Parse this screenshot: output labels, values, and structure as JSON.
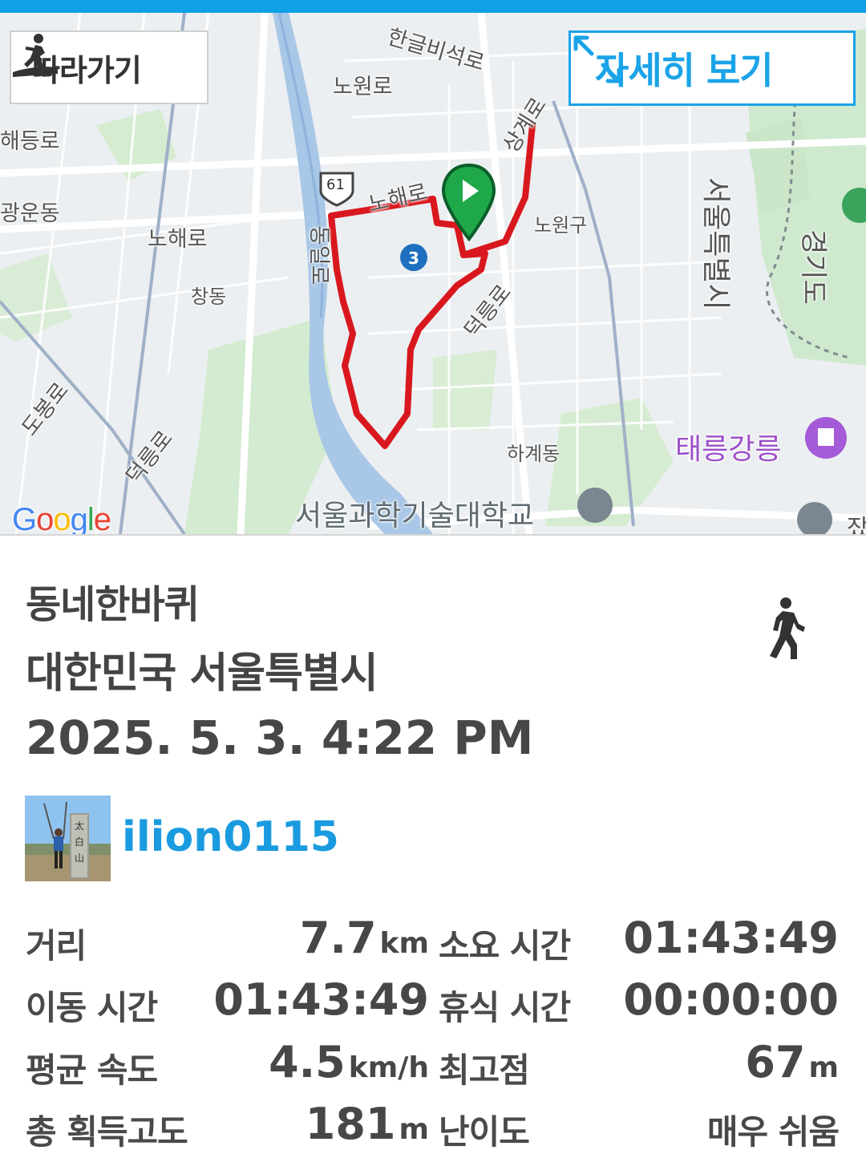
{
  "map": {
    "follow_label": "따라가기",
    "detail_label": "자세히 보기",
    "google_logo": "Google",
    "labels": {
      "hangeul_biseok_ro": "한글비석로",
      "nowon_ro": "노원로",
      "sanggye_ro": "상계로",
      "haedeung_ro": "해등로",
      "nohae_ro_main": "노해로",
      "nohae_ro_left": "노해로",
      "wolgye_dong": "광운동",
      "chang_dong": "창동",
      "route_61": "61",
      "jungnangcheon_ro": "동일로",
      "nowon_gu": "노원구",
      "subway_3": "3",
      "deokneung_ro_right": "덕릉로",
      "seoul_city": "서울특별시",
      "gyeonggi_do": "경기도",
      "dobong_ro": "도봉로",
      "deokneung_ro_left": "덕릉로",
      "hagye_dong": "하계동",
      "taereung": "태릉강릉",
      "seoultech": "서울과학기술대학교",
      "edge_label": "잤"
    }
  },
  "route": {
    "title": "동네한바퀴",
    "location": "대한민국 서울특별시",
    "datetime": "2025. 5. 3. 4:22 PM",
    "activity_icon": "walking-person-icon",
    "username": "ilion0115"
  },
  "stats": {
    "distance_label": "거리",
    "distance_value": "7.7",
    "distance_unit": "km",
    "total_time_label": "소요 시간",
    "total_time_value": "01:43:49",
    "moving_time_label": "이동 시간",
    "moving_time_value": "01:43:49",
    "rest_time_label": "휴식 시간",
    "rest_time_value": "00:00:00",
    "avg_speed_label": "평균 속도",
    "avg_speed_value": "4.5",
    "avg_speed_unit": "km/h",
    "max_alt_label": "최고점",
    "max_alt_value": "67",
    "max_alt_unit": "m",
    "total_ascent_label": "총 획득고도",
    "total_ascent_value": "181",
    "total_ascent_unit": "m",
    "difficulty_label": "난이도",
    "difficulty_value": "매우 쉬움"
  },
  "colors": {
    "accent": "#1aa3e8",
    "route": "#d8181e",
    "start_marker": "#1fa84a",
    "username": "#1a9be0"
  }
}
